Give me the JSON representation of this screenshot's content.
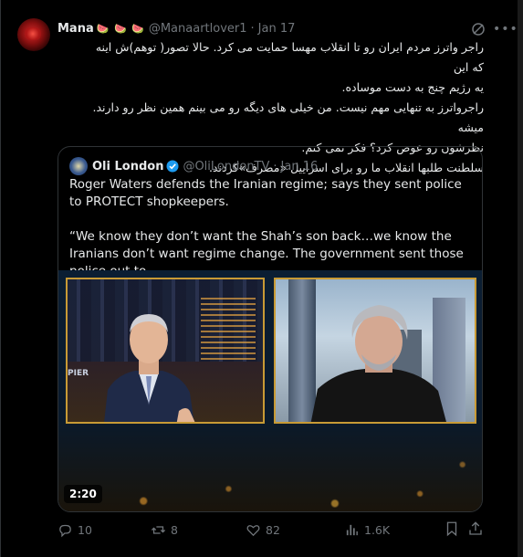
{
  "post": {
    "author_name": "Mana",
    "author_emoji": "🍉 🍉 🍉",
    "author_handle": "@Manaartlover1",
    "separator": "·",
    "date": "Jan 17",
    "text_lines": [
      "راجر واترز مردم ایران رو تا انقلاب مهسا حمایت می کرد. حالا تصور( توهم)ش اینه که این",
      "یه رژیم چنج به دست موساده.",
      "راجرواترز به تنهایی مهم نیست. من خیلی های دیگه رو می بینم همین نظر رو دارند. میشه",
      "نظرشون رو عوض کرد؟ فکر نمی کنم.",
      "سلطنت طلبها انقلاب ما رو برای اسراییل «مصرف»کردند."
    ]
  },
  "quoted": {
    "author_name": "Oli London",
    "author_handle": "@OliLondonTV",
    "separator": "·",
    "date": "Jan 16",
    "text": "Roger Waters defends the Iranian regime; says they sent police to PROTECT shopkeepers.\n\n“We know they don’t want the Shah’s son back…we know the Iranians don’t want regime change. The government sent those police out to …",
    "video_duration": "2:20",
    "video_sign_text": "PIER"
  },
  "actions": {
    "replies": "10",
    "reposts": "8",
    "likes": "82",
    "views": "1.6K"
  },
  "colors": {
    "background": "#000000",
    "text_primary": "#e7e9ea",
    "text_secondary": "#71767b",
    "border": "#2f3336",
    "verified": "#1d9bf0"
  }
}
